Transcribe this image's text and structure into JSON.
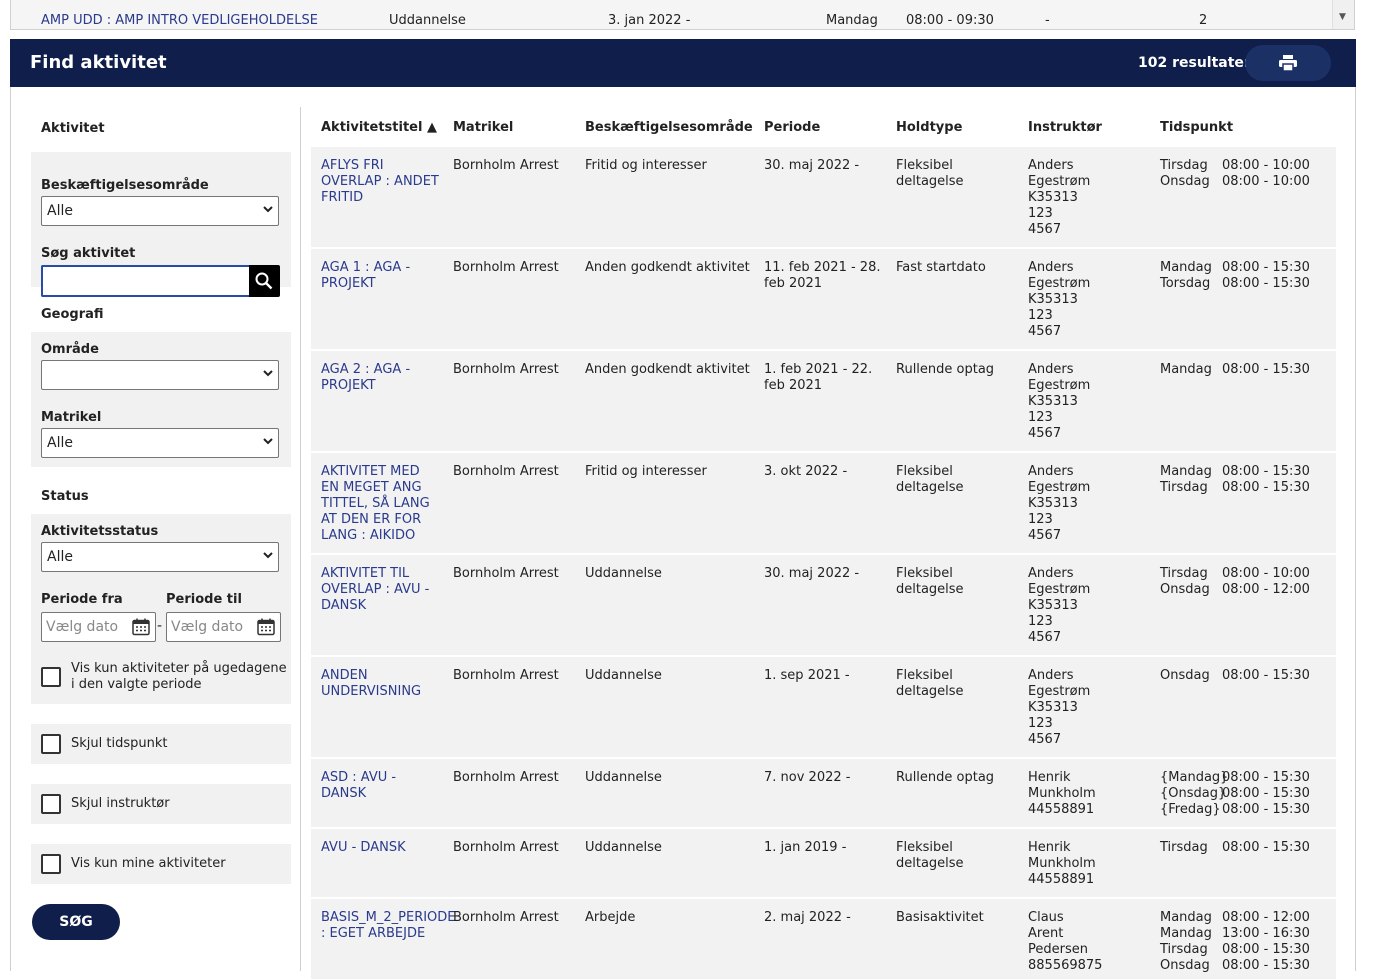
{
  "top_row": {
    "title": "AMP UDD : AMP INTRO VEDLIGEHOLDELSE",
    "category": "Uddannelse",
    "date": "3. jan 2022 -",
    "day": "Mandag",
    "time": "08:00 - 09:30",
    "dash": "-",
    "count": "2"
  },
  "header": {
    "title": "Find aktivitet",
    "results": "102 resultater"
  },
  "sidebar": {
    "aktivitet_title": "Aktivitet",
    "beskaeftigelse_label": "Beskæftigelsesområde",
    "beskaeftigelse_value": "Alle",
    "soeg_label": "Søg aktivitet",
    "soeg_value": "",
    "geografi_title": "Geografi",
    "omraade_label": "Område",
    "omraade_value": "",
    "matrikel_label": "Matrikel",
    "matrikel_value": "Alle",
    "status_title": "Status",
    "aktivitetsstatus_label": "Aktivitetsstatus",
    "aktivitetsstatus_value": "Alle",
    "periode_fra_label": "Periode fra",
    "periode_til_label": "Periode til",
    "date_placeholder": "Vælg dato",
    "date_sep": "-",
    "cb_weekdays": "Vis kun aktiviteter på ugedagene i den valgte periode",
    "cb_hide_time": "Skjul tidspunkt",
    "cb_hide_instructor": "Skjul instruktør",
    "cb_mine": "Vis kun mine aktiviteter",
    "submit": "SØG"
  },
  "table": {
    "headers": [
      "Aktivitetstitel ▲",
      "Matrikel",
      "Beskæftigelsesområde",
      "Periode",
      "Holdtype",
      "Instruktør",
      "Tidspunkt"
    ],
    "rows": [
      {
        "title": "AFLYS FRI OVERLAP : ANDET FRITID",
        "matrikel": "Bornholm Arrest",
        "besk": "Fritid og interesser",
        "periode": "30. maj 2022 -",
        "holdtype": "Fleksibel deltagelse",
        "instr": [
          "Anders",
          "Egestrøm",
          "K35313",
          "123",
          "4567"
        ],
        "times": [
          {
            "day": "Tirsdag",
            "time": "08:00 - 10:00"
          },
          {
            "day": "Onsdag",
            "time": "08:00 - 10:00"
          }
        ]
      },
      {
        "title": "AGA 1 : AGA - PROJEKT",
        "matrikel": "Bornholm Arrest",
        "besk": "Anden godkendt aktivitet",
        "periode": "11. feb 2021 - 28. feb 2021",
        "holdtype": "Fast startdato",
        "instr": [
          "Anders",
          "Egestrøm",
          "K35313",
          "123",
          "4567"
        ],
        "times": [
          {
            "day": "Mandag",
            "time": "08:00 - 15:30"
          },
          {
            "day": "Torsdag",
            "time": "08:00 - 15:30"
          }
        ]
      },
      {
        "title": "AGA 2 : AGA - PROJEKT",
        "matrikel": "Bornholm Arrest",
        "besk": "Anden godkendt aktivitet",
        "periode": "1. feb 2021 - 22. feb 2021",
        "holdtype": "Rullende optag",
        "instr": [
          "Anders",
          "Egestrøm",
          "K35313",
          "123",
          "4567"
        ],
        "times": [
          {
            "day": "Mandag",
            "time": "08:00 - 15:30"
          }
        ]
      },
      {
        "title": "AKTIVITET MED EN MEGET ANG TITTEL, SÅ LANG AT DEN ER FOR LANG : AIKIDO",
        "matrikel": "Bornholm Arrest",
        "besk": "Fritid og interesser",
        "periode": "3. okt 2022 -",
        "holdtype": "Fleksibel deltagelse",
        "instr": [
          "Anders",
          "Egestrøm",
          "K35313",
          "123",
          "4567"
        ],
        "times": [
          {
            "day": "Mandag",
            "time": "08:00 - 15:30"
          },
          {
            "day": "Tirsdag",
            "time": "08:00 - 15:30"
          }
        ]
      },
      {
        "title": "AKTIVITET TIL OVERLAP : AVU - DANSK",
        "matrikel": "Bornholm Arrest",
        "besk": "Uddannelse",
        "periode": "30. maj 2022 -",
        "holdtype": "Fleksibel deltagelse",
        "instr": [
          "Anders",
          "Egestrøm",
          "K35313",
          "123",
          "4567"
        ],
        "times": [
          {
            "day": "Tirsdag",
            "time": "08:00 - 10:00"
          },
          {
            "day": "Onsdag",
            "time": "08:00 - 12:00"
          }
        ]
      },
      {
        "title": "ANDEN UNDERVISNING",
        "matrikel": "Bornholm Arrest",
        "besk": "Uddannelse",
        "periode": "1. sep 2021 -",
        "holdtype": "Fleksibel deltagelse",
        "instr": [
          "Anders",
          "Egestrøm",
          "K35313",
          "123",
          "4567"
        ],
        "times": [
          {
            "day": "Onsdag",
            "time": "08:00 - 15:30"
          }
        ]
      },
      {
        "title": "ASD : AVU - DANSK",
        "matrikel": "Bornholm Arrest",
        "besk": "Uddannelse",
        "periode": "7. nov 2022 -",
        "holdtype": "Rullende optag",
        "instr": [
          "Henrik",
          "Munkholm",
          "44558891"
        ],
        "times": [
          {
            "day": "{Mandag}",
            "time": "08:00 - 15:30"
          },
          {
            "day": "{Onsdag}",
            "time": "08:00 - 15:30"
          },
          {
            "day": "{Fredag}",
            "time": "08:00 - 15:30"
          }
        ]
      },
      {
        "title": "AVU - DANSK",
        "matrikel": "Bornholm Arrest",
        "besk": "Uddannelse",
        "periode": "1. jan 2019 -",
        "holdtype": "Fleksibel deltagelse",
        "instr": [
          "Henrik",
          "Munkholm",
          "44558891"
        ],
        "times": [
          {
            "day": "Tirsdag",
            "time": "08:00 - 15:30"
          }
        ]
      },
      {
        "title": "BASIS_M_2_PERIODE : EGET ARBEJDE",
        "matrikel": "Bornholm Arrest",
        "besk": "Arbejde",
        "periode": "2. maj 2022 -",
        "holdtype": "Basisaktivitet",
        "instr": [
          "Claus",
          "Arent",
          "Pedersen",
          "885569875"
        ],
        "times": [
          {
            "day": "Mandag",
            "time": "08:00 - 12:00"
          },
          {
            "day": "Mandag",
            "time": "13:00 - 16:30"
          },
          {
            "day": "Tirsdag",
            "time": "08:00 - 15:30"
          },
          {
            "day": "Onsdag",
            "time": "08:00 - 15:30"
          }
        ]
      }
    ]
  }
}
